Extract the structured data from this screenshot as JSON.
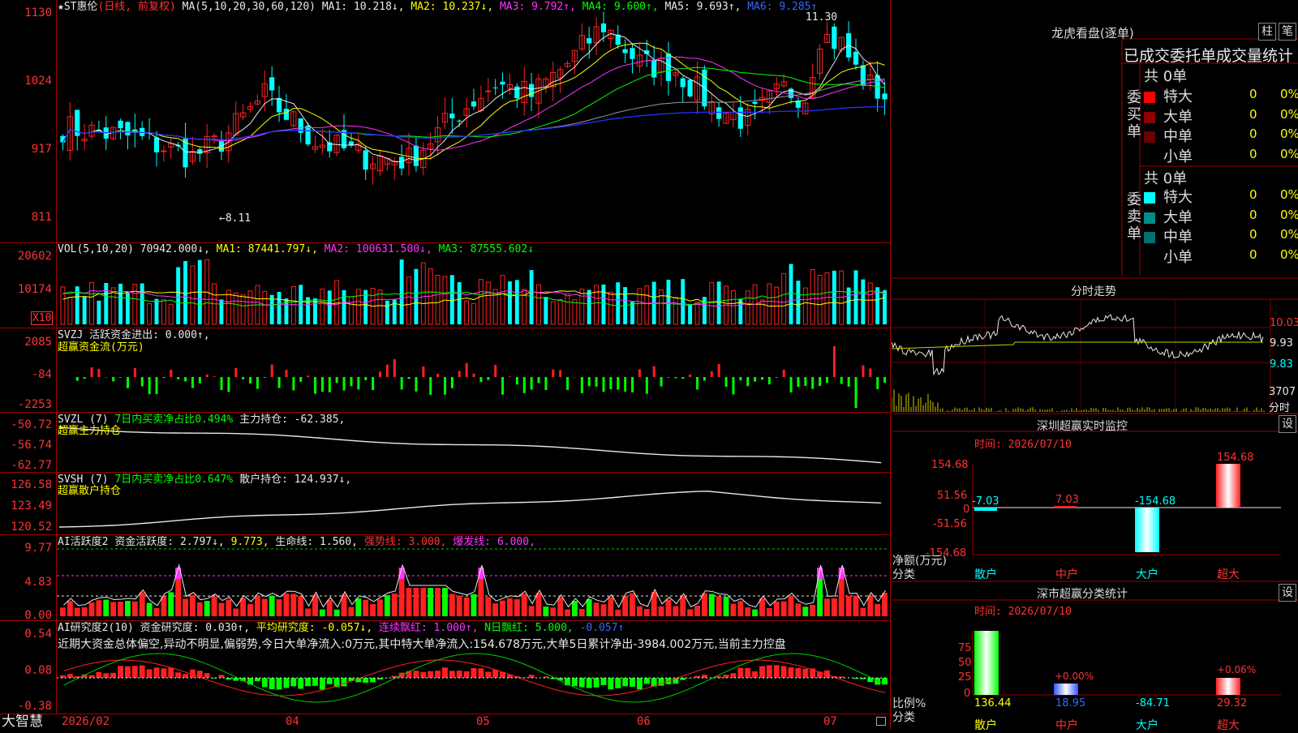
{
  "main_chart": {
    "title_name": "★ST惠伦",
    "title_mode": "(日线, 前复权)",
    "ma_label": "MA(5,10,20,30,60,120)",
    "ma1": "MA1: 10.218↓,",
    "ma2": "MA2: 10.237↓,",
    "ma3": "MA3: 9.792↑,",
    "ma4": "MA4: 9.600↑,",
    "ma5": "MA5: 9.693↑,",
    "ma6": "MA6: 9.285↑",
    "high_mark": "11.30",
    "low_mark": "←8.11",
    "y_ticks": [
      "1130",
      "1024",
      "917",
      "811"
    ]
  },
  "vol_panel": {
    "label": "VOL(5,10,20)",
    "value": "70942.000↓,",
    "ma1": "MA1: 87441.797↓,",
    "ma2": "MA2: 100631.500↓,",
    "ma3": "MA3: 87555.602↓",
    "y_ticks": [
      "20602",
      "10174"
    ],
    "unit": "X10"
  },
  "svzj_panel": {
    "label": "SVZJ",
    "value": "活跃资金进出: 0.000↑,",
    "sub": "超赢资金流(万元)",
    "y_ticks": [
      "2085",
      "-84",
      "-2253"
    ]
  },
  "svzl_panel": {
    "label": "SVZL (7)",
    "ratio": "7日内买卖净占比0.494%",
    "hold": "主力持仓: -62.385,",
    "sub": "超赢主力持仓",
    "y_ticks": [
      "-50.72",
      "-56.74",
      "-62.77"
    ]
  },
  "svsh_panel": {
    "label": "SVSH (7)",
    "ratio": "7日内买卖净占比0.647%",
    "hold": "散户持仓: 124.937↓,",
    "sub": "超赢散户持仓",
    "y_ticks": [
      "126.58",
      "123.49",
      "120.52"
    ]
  },
  "ai_active_panel": {
    "label": "AI活跃度2",
    "v1": "资金活跃度: 2.797↓,",
    "v2": "9.773,",
    "v3": "生命线: 1.560,",
    "v4": "强势线: 3.000,",
    "v5": "爆发线: 6.000,",
    "y_ticks": [
      "9.77",
      "4.83",
      "0.00"
    ]
  },
  "ai_research_panel": {
    "label": "AI研究度2(10)",
    "v1": "资金研究度: 0.030↑,",
    "v2": "平均研究度: -0.057↓,",
    "v3": "连续飘红: 1.000↑,",
    "v4": "N日飘红: 5.000,",
    "v5": "-0.057↑",
    "summary": "近期大资金总体偏空,异动不明显,偏弱势,今日大单净流入:0万元,其中特大单净流入:154.678万元,大单5日累计净出-3984.002万元,当前主力控盘",
    "y_ticks": [
      "0.54",
      "0.08",
      "-0.38"
    ]
  },
  "x_axis": {
    "brand": "大智慧",
    "labels": [
      "2026/02",
      "04",
      "05",
      "06",
      "07"
    ]
  },
  "dragon_tiger": {
    "title": "龙虎看盘(逐单)",
    "tab_bar": "柱",
    "tab_pen": "笔",
    "header": "已成交委托单成交量统计",
    "buy_label": "委买单",
    "sell_label": "委卖单",
    "buy_total": "共 0单",
    "sell_total": "共 0单",
    "buy_rows": [
      {
        "name": "特大",
        "count": "0",
        "pct": "0%",
        "color": "#ff0000"
      },
      {
        "name": "大单",
        "count": "0",
        "pct": "0%",
        "color": "#8b0000"
      },
      {
        "name": "中单",
        "count": "0",
        "pct": "0%",
        "color": "#6b0000"
      },
      {
        "name": "小单",
        "count": "0",
        "pct": "0%",
        "color": ""
      }
    ],
    "sell_rows": [
      {
        "name": "特大",
        "count": "0",
        "pct": "0%",
        "color": "#00ffff"
      },
      {
        "name": "大单",
        "count": "0",
        "pct": "0%",
        "color": "#008b8b"
      },
      {
        "name": "中单",
        "count": "0",
        "pct": "0%",
        "color": "#007070"
      },
      {
        "name": "小单",
        "count": "0",
        "pct": "0%",
        "color": ""
      }
    ]
  },
  "intraday": {
    "title": "分时走势",
    "p_high": "10.03",
    "p_mid": "9.93",
    "p_low": "9.83",
    "vol_val": "3707",
    "vol_unit": "分时"
  },
  "sz_monitor": {
    "title": "深圳超赢实时监控",
    "settings": "设",
    "time": "时间: 2026/07/10",
    "y_ticks": [
      "154.68",
      "51.56",
      "0",
      "-51.56",
      "-154.68"
    ],
    "net_label": "净额(万元)",
    "cat_label": "分类",
    "categories": [
      "散户",
      "中户",
      "大户",
      "超大"
    ],
    "values": [
      "-7.03",
      "7.03",
      "-154.68",
      "154.68"
    ]
  },
  "sz_class": {
    "title": "深市超赢分类统计",
    "settings": "设",
    "time": "时间: 2026/07/10",
    "y_ticks": [
      "75",
      "50",
      "25",
      "0"
    ],
    "ratio_label": "比例%",
    "cat_label": "分类",
    "categories": [
      "散户",
      "中户",
      "大户",
      "超大"
    ],
    "values": [
      "136.44",
      "18.95",
      "-84.71",
      "29.32"
    ],
    "pct_labels": [
      "+0.00%",
      "+0.06%"
    ]
  },
  "chart_data": {
    "type": "candlestick",
    "title": "★ST惠伦",
    "x_axis_labels": [
      "2026/02",
      "04",
      "05",
      "06",
      "07"
    ],
    "y_ticks": [
      11.3,
      10.24,
      9.17,
      8.11
    ],
    "high": 11.3,
    "low": 8.11,
    "series": [
      {
        "name": "MA1",
        "last": 10.218
      },
      {
        "name": "MA2",
        "last": 10.237
      },
      {
        "name": "MA3",
        "last": 9.792
      },
      {
        "name": "MA4",
        "last": 9.6
      },
      {
        "name": "MA5",
        "last": 9.693
      },
      {
        "name": "MA6",
        "last": 9.285
      }
    ]
  }
}
